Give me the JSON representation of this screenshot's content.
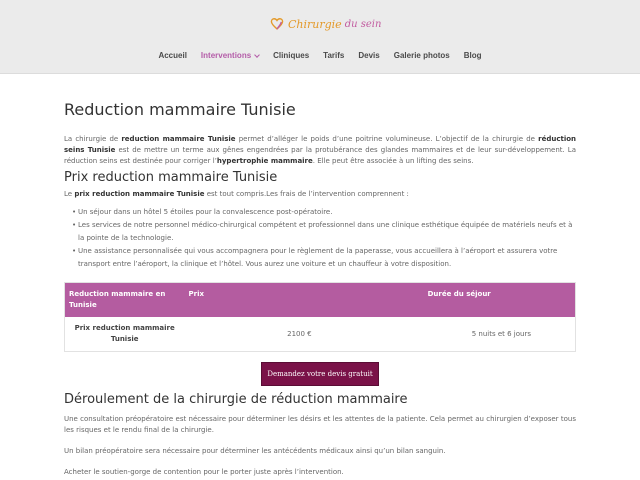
{
  "header": {
    "logo_main": "Chirurgie",
    "logo_sub": "du sein"
  },
  "nav": {
    "items": [
      {
        "label": "Accueil"
      },
      {
        "label": "Interventions"
      },
      {
        "label": "Cliniques"
      },
      {
        "label": "Tarifs"
      },
      {
        "label": "Devis"
      },
      {
        "label": "Galerie photos"
      },
      {
        "label": "Blog"
      }
    ]
  },
  "main": {
    "title": "Reduction mammaire Tunisie",
    "intro": {
      "t1": "La chirurgie de ",
      "b1": "reduction mammaire Tunisie",
      "t2": " permet d’alléger le poids d’une poitrine volumineuse. L’objectif de la chirurgie de ",
      "b2": "réduction seins Tunisie",
      "t3": " est de mettre un terme aux gênes engendrées par la protubérance des glandes mammaires et de leur sur-développement. La réduction seins est destinée pour corriger l’",
      "b3": "hypertrophie mammaire",
      "t4": ". Elle peut être associée à un lifting des seins."
    },
    "prix_title": "Prix reduction mammaire Tunisie",
    "prix_lead": {
      "t1": "Le ",
      "b1": "prix reduction mammaire Tunisie",
      "t2": " est tout compris.Les frais de l’intervention comprennent :"
    },
    "list": [
      "Un séjour dans un hôtel 5 étoiles pour la convalescence post-opératoire.",
      "Les services de notre personnel médico-chirurgical compétent et professionnel dans une clinique esthétique équipée de matériels neufs et à la pointe de la technologie.",
      "Une assistance personnalisée qui vous accompagnera pour le règlement de la paperasse, vous accueillera à l’aéroport et assurera votre transport entre l’aéroport, la clinique et l’hôtel. Vous aurez une voiture et un chauffeur à votre disposition."
    ],
    "table": {
      "headers": [
        "Reduction mammaire en Tunisie",
        "Prix",
        "Durée du séjour"
      ],
      "row": [
        "Prix reduction mammaire Tunisie",
        "2100 €",
        "5 nuits et 6 jours"
      ]
    },
    "cta_label": "Demandez votre devis gratuit",
    "deroulement_title": "Déroulement de la chirurgie de réduction mammaire",
    "deroulement": [
      " Une consultation préopératoire est nécessaire pour déterminer les désirs et les attentes de la patiente. Cela permet au chirurgien d’exposer tous les risques et le rendu final de la chirurgie.",
      "Un bilan préopératoire sera nécessaire pour déterminer les antécédents médicaux ainsi qu’un bilan sanguin.",
      "Acheter le soutien-gorge de contention pour le porter juste après l’intervention."
    ]
  }
}
